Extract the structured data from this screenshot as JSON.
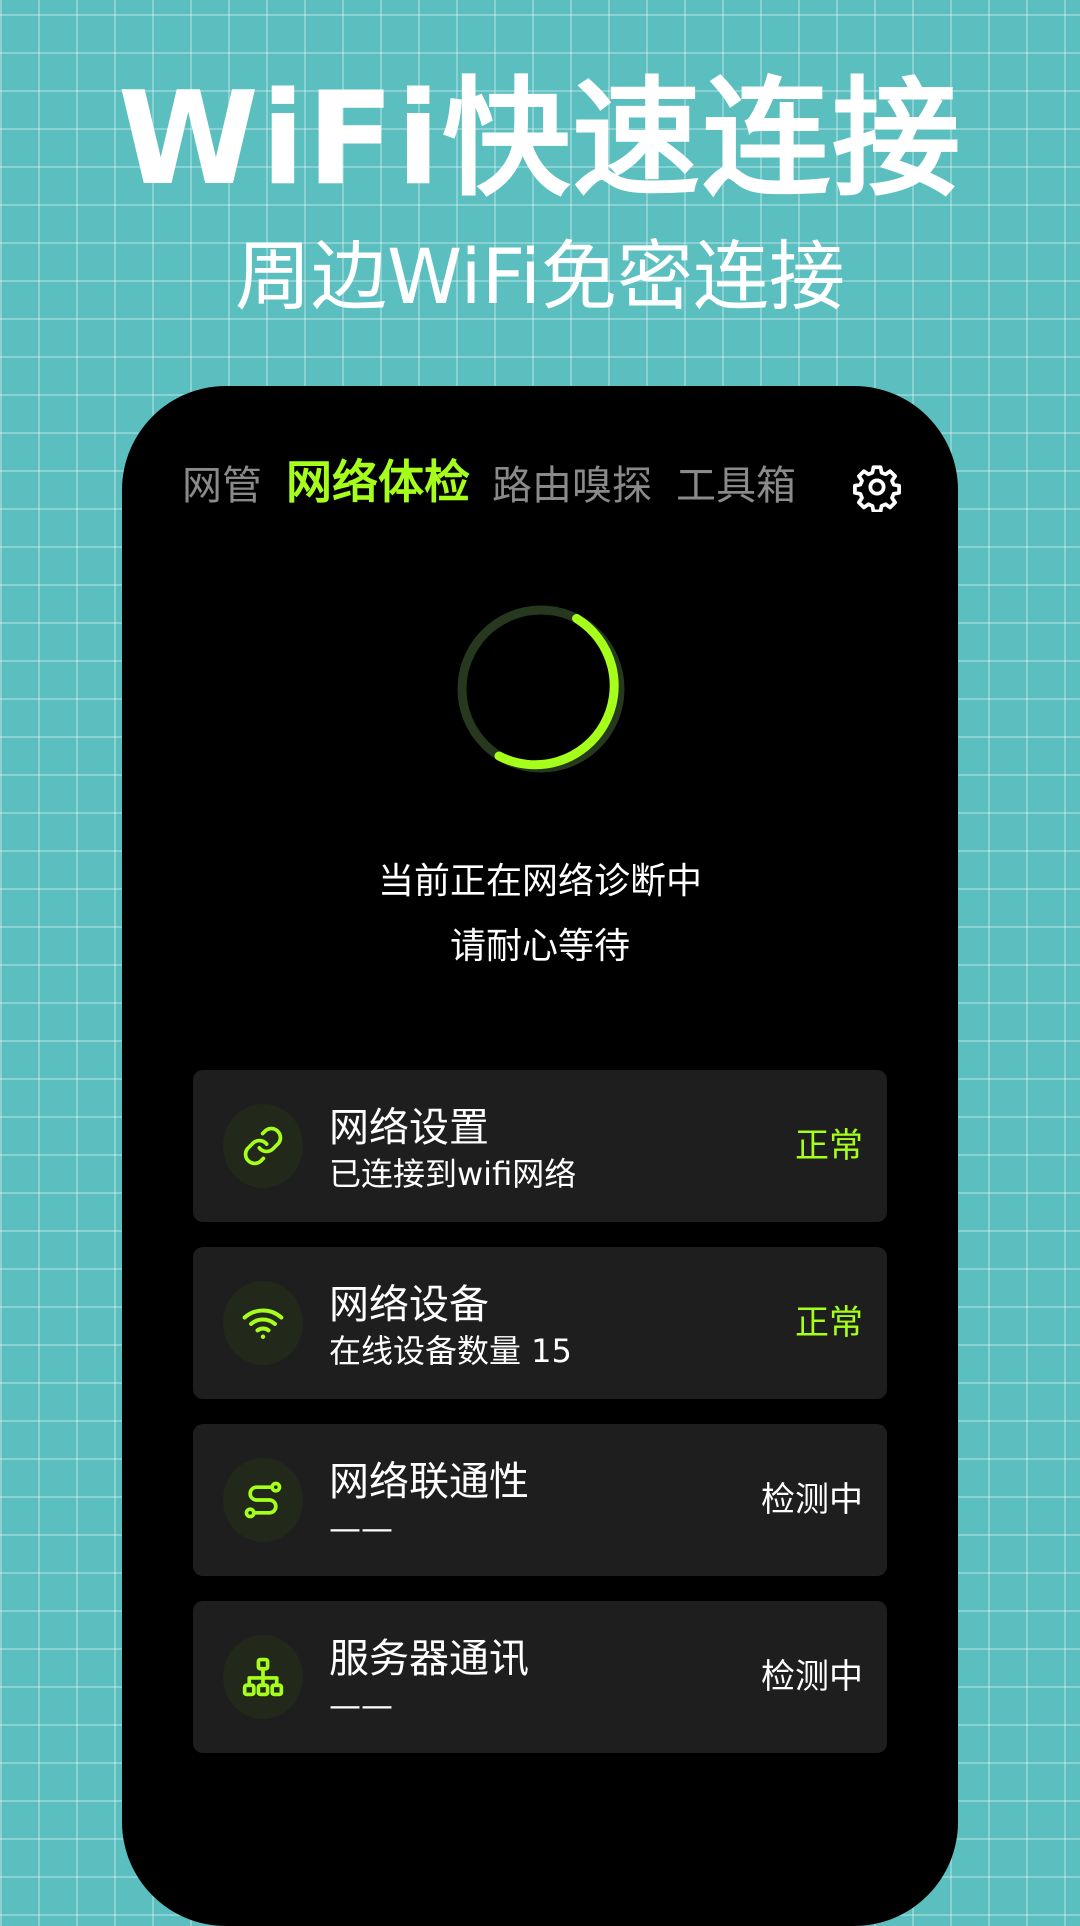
{
  "promo": {
    "headline": "WiFi快速连接",
    "subheadline": "周边WiFi免密连接"
  },
  "tabs": [
    {
      "label": "网管",
      "active": false
    },
    {
      "label": "网络体检",
      "active": true
    },
    {
      "label": "路由嗅探",
      "active": false
    },
    {
      "label": "工具箱",
      "active": false
    }
  ],
  "settings_icon": "gear-icon",
  "diagnosis": {
    "line1": "当前正在网络诊断中",
    "line2": "请耐心等待"
  },
  "cards": [
    {
      "icon": "link-icon",
      "title": "网络设置",
      "subtitle": "已连接到wifi网络",
      "status": "正常"
    },
    {
      "icon": "wifi-icon",
      "title": "网络设备",
      "subtitle": "在线设备数量 15",
      "status": "正常"
    },
    {
      "icon": "route-icon",
      "title": "网络联通性",
      "subtitle": "——",
      "status": "检测中"
    },
    {
      "icon": "network-tree-icon",
      "title": "服务器通讯",
      "subtitle": "——",
      "status": "检测中"
    }
  ],
  "colors": {
    "accent": "#a6ff1a",
    "background": "#5bbfc0",
    "card": "#1e1e1f",
    "phone": "#000000"
  }
}
